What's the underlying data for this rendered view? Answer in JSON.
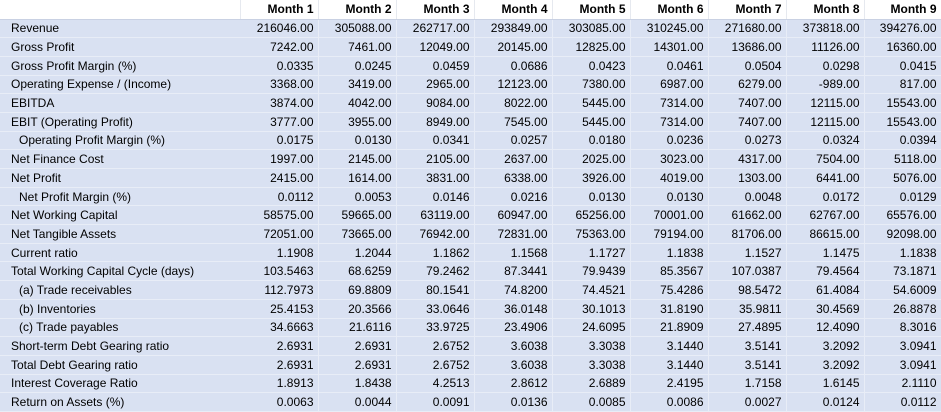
{
  "columns": [
    "Month 1",
    "Month 2",
    "Month 3",
    "Month 4",
    "Month 5",
    "Month 6",
    "Month 7",
    "Month 8",
    "Month 9"
  ],
  "rows": [
    {
      "label": "Revenue",
      "indent": 0,
      "values": [
        "216046.00",
        "305088.00",
        "262717.00",
        "293849.00",
        "303085.00",
        "310245.00",
        "271680.00",
        "373818.00",
        "394276.00"
      ]
    },
    {
      "label": "Gross Profit",
      "indent": 0,
      "values": [
        "7242.00",
        "7461.00",
        "12049.00",
        "20145.00",
        "12825.00",
        "14301.00",
        "13686.00",
        "11126.00",
        "16360.00"
      ]
    },
    {
      "label": "Gross Profit Margin (%)",
      "indent": 0,
      "values": [
        "0.0335",
        "0.0245",
        "0.0459",
        "0.0686",
        "0.0423",
        "0.0461",
        "0.0504",
        "0.0298",
        "0.0415"
      ]
    },
    {
      "label": "Operating Expense / (Income)",
      "indent": 0,
      "values": [
        "3368.00",
        "3419.00",
        "2965.00",
        "12123.00",
        "7380.00",
        "6987.00",
        "6279.00",
        "-989.00",
        "817.00"
      ]
    },
    {
      "label": "EBITDA",
      "indent": 0,
      "values": [
        "3874.00",
        "4042.00",
        "9084.00",
        "8022.00",
        "5445.00",
        "7314.00",
        "7407.00",
        "12115.00",
        "15543.00"
      ]
    },
    {
      "label": "EBIT (Operating Profit)",
      "indent": 0,
      "values": [
        "3777.00",
        "3955.00",
        "8949.00",
        "7545.00",
        "5445.00",
        "7314.00",
        "7407.00",
        "12115.00",
        "15543.00"
      ]
    },
    {
      "label": "Operating Profit Margin (%)",
      "indent": 1,
      "values": [
        "0.0175",
        "0.0130",
        "0.0341",
        "0.0257",
        "0.0180",
        "0.0236",
        "0.0273",
        "0.0324",
        "0.0394"
      ]
    },
    {
      "label": "Net Finance Cost",
      "indent": 0,
      "values": [
        "1997.00",
        "2145.00",
        "2105.00",
        "2637.00",
        "2025.00",
        "3023.00",
        "4317.00",
        "7504.00",
        "5118.00"
      ]
    },
    {
      "label": "Net Profit",
      "indent": 0,
      "values": [
        "2415.00",
        "1614.00",
        "3831.00",
        "6338.00",
        "3926.00",
        "4019.00",
        "1303.00",
        "6441.00",
        "5076.00"
      ]
    },
    {
      "label": "Net Profit Margin (%)",
      "indent": 1,
      "values": [
        "0.0112",
        "0.0053",
        "0.0146",
        "0.0216",
        "0.0130",
        "0.0130",
        "0.0048",
        "0.0172",
        "0.0129"
      ]
    },
    {
      "label": "Net Working Capital",
      "indent": 0,
      "values": [
        "58575.00",
        "59665.00",
        "63119.00",
        "60947.00",
        "65256.00",
        "70001.00",
        "61662.00",
        "62767.00",
        "65576.00"
      ]
    },
    {
      "label": "Net Tangible Assets",
      "indent": 0,
      "values": [
        "72051.00",
        "73665.00",
        "76942.00",
        "72831.00",
        "75363.00",
        "79194.00",
        "81706.00",
        "86615.00",
        "92098.00"
      ]
    },
    {
      "label": "Current ratio",
      "indent": 0,
      "values": [
        "1.1908",
        "1.2044",
        "1.1862",
        "1.1568",
        "1.1727",
        "1.1838",
        "1.1527",
        "1.1475",
        "1.1838"
      ]
    },
    {
      "label": "Total Working Capital Cycle (days)",
      "indent": 0,
      "values": [
        "103.5463",
        "68.6259",
        "79.2462",
        "87.3441",
        "79.9439",
        "85.3567",
        "107.0387",
        "79.4564",
        "73.1871"
      ]
    },
    {
      "label": "(a) Trade receivables",
      "indent": 2,
      "values": [
        "112.7973",
        "69.8809",
        "80.1541",
        "74.8200",
        "74.4521",
        "75.4286",
        "98.5472",
        "61.4084",
        "54.6009"
      ]
    },
    {
      "label": "(b) Inventories",
      "indent": 2,
      "values": [
        "25.4153",
        "20.3566",
        "33.0646",
        "36.0148",
        "30.1013",
        "31.8190",
        "35.9811",
        "30.4569",
        "26.8878"
      ]
    },
    {
      "label": "(c) Trade payables",
      "indent": 2,
      "values": [
        "34.6663",
        "21.6116",
        "33.9725",
        "23.4906",
        "24.6095",
        "21.8909",
        "27.4895",
        "12.4090",
        "8.3016"
      ]
    },
    {
      "label": "Short-term Debt Gearing ratio",
      "indent": 0,
      "values": [
        "2.6931",
        "2.6931",
        "2.6752",
        "3.6038",
        "3.3038",
        "3.1440",
        "3.5141",
        "3.2092",
        "3.0941"
      ]
    },
    {
      "label": "Total Debt Gearing ratio",
      "indent": 0,
      "values": [
        "2.6931",
        "2.6931",
        "2.6752",
        "3.6038",
        "3.3038",
        "3.1440",
        "3.5141",
        "3.2092",
        "3.0941"
      ]
    },
    {
      "label": "Interest Coverage Ratio",
      "indent": 0,
      "values": [
        "1.8913",
        "1.8438",
        "4.2513",
        "2.8612",
        "2.6889",
        "2.4195",
        "1.7158",
        "1.6145",
        "2.1110"
      ]
    },
    {
      "label": "Return on Assets (%)",
      "indent": 0,
      "values": [
        "0.0063",
        "0.0044",
        "0.0091",
        "0.0136",
        "0.0085",
        "0.0086",
        "0.0027",
        "0.0124",
        "0.0112"
      ]
    }
  ]
}
